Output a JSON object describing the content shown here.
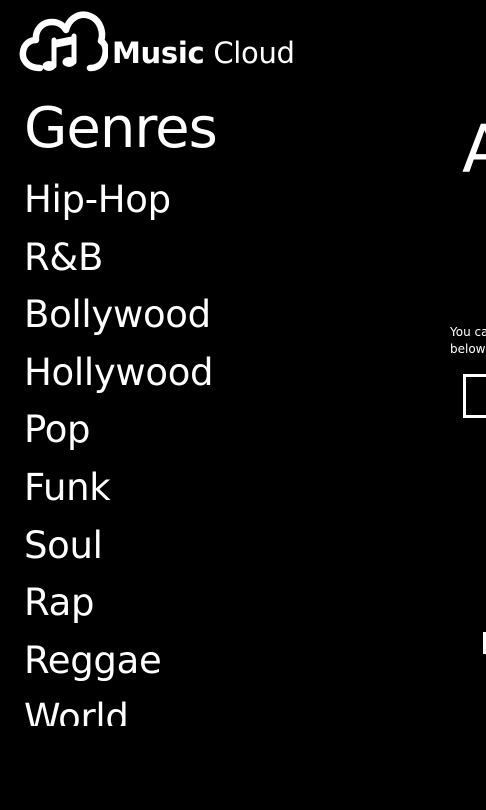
{
  "header": {
    "logo_icon": "cloud-music-note-icon",
    "title_bold": "Music",
    "title_light": " Cloud"
  },
  "genres": {
    "heading": "Genres",
    "items": [
      "Hip-Hop",
      "R&B",
      "Bollywood",
      "Hollywood",
      "Pop",
      "Funk",
      "Soul",
      "Rap",
      "Reggae",
      "World"
    ]
  },
  "side_panel": {
    "title_fragment": "A",
    "text_line1": "You ca",
    "text_line2": "below"
  },
  "colors": {
    "background": "#000000",
    "foreground": "#ffffff"
  }
}
